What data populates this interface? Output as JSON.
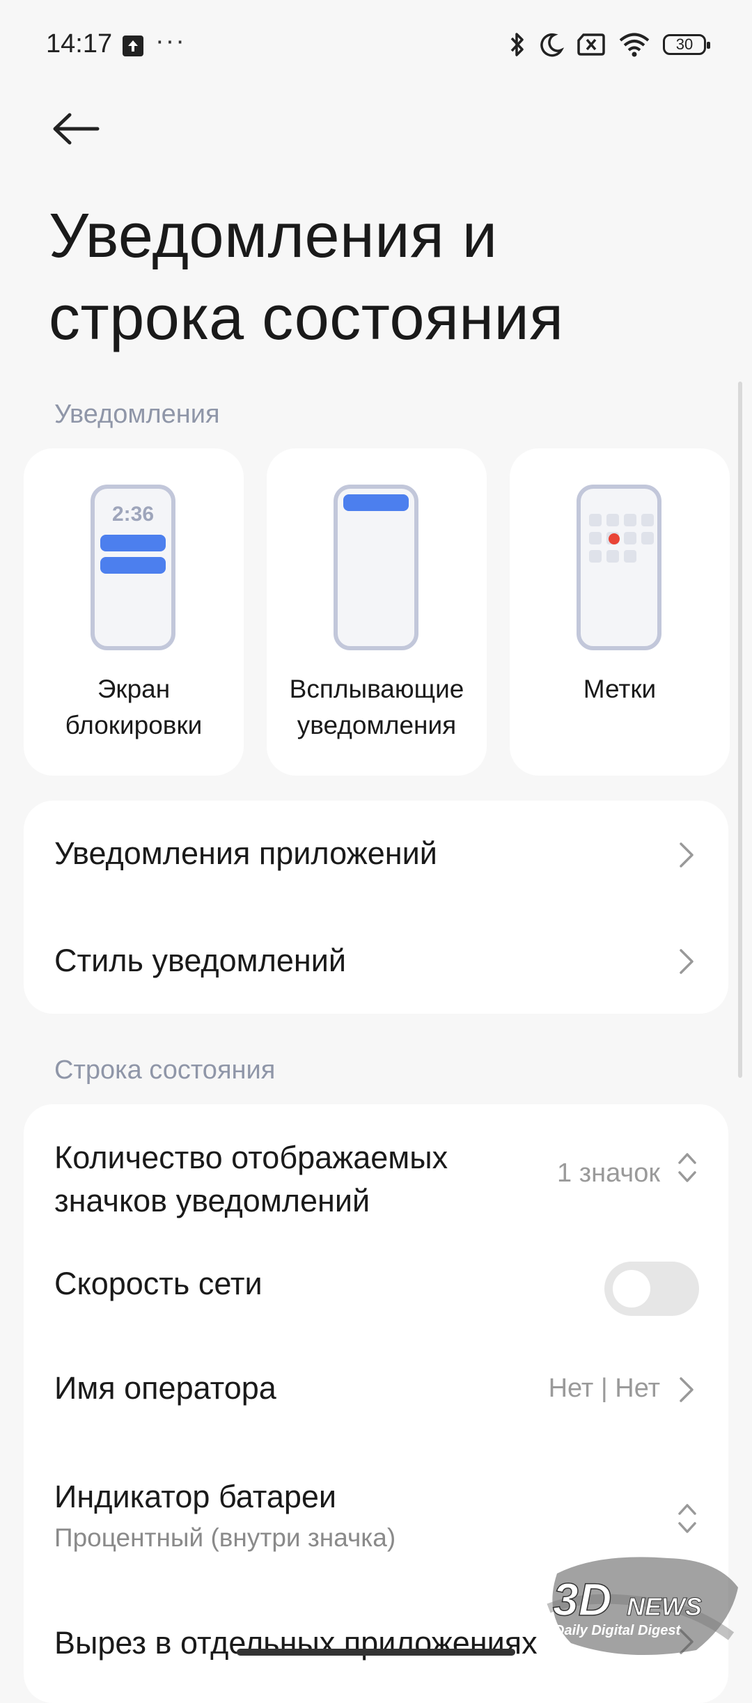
{
  "status_bar": {
    "time": "14:17",
    "dots": "···",
    "battery": "30"
  },
  "header": {
    "title": "Уведомления и строка состояния"
  },
  "notifications": {
    "section_label": "Уведомления",
    "tiles": [
      {
        "label": "Экран\nблокировки",
        "preview_time": "2:36"
      },
      {
        "label": "Всплывающие\nуведомления"
      },
      {
        "label": "Метки"
      }
    ],
    "rows": [
      {
        "label": "Уведомления приложений"
      },
      {
        "label": "Стиль уведомлений"
      }
    ]
  },
  "status_section": {
    "section_label": "Строка состояния",
    "rows": [
      {
        "label": "Количество отображаемых\nзначков уведомлений",
        "value": "1 значок"
      },
      {
        "label": "Скорость сети",
        "toggle_on": false
      },
      {
        "label": "Имя оператора",
        "value": "Нет | Нет"
      },
      {
        "label": "Индикатор батареи",
        "sub": "Процентный (внутри значка)"
      },
      {
        "label": "Вырез в отдельных приложениях"
      }
    ]
  },
  "watermark": {
    "logo": "3DNEWS",
    "tagline": "Daily Digital Digest"
  }
}
